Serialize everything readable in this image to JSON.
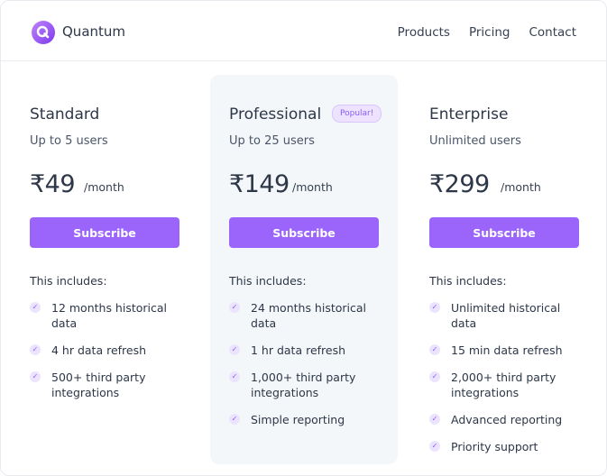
{
  "brand": {
    "name": "Quantum",
    "logo_icon": "q-logo-icon",
    "accent": "#8b5cf6"
  },
  "nav": {
    "links": [
      "Products",
      "Pricing",
      "Contact"
    ]
  },
  "plans": [
    {
      "name": "Standard",
      "users": "Up to 5 users",
      "price": "₹49",
      "period": "/month",
      "button": "Subscribe",
      "includes_label": "This includes:",
      "features": [
        "12 months historical data",
        "4 hr data refresh",
        "500+ third party integrations"
      ]
    },
    {
      "name": "Professional",
      "badge": "Popular!",
      "users": "Up to 25 users",
      "price": "₹149",
      "period": "/month",
      "button": "Subscribe",
      "includes_label": "This includes:",
      "features": [
        "24 months historical data",
        "1 hr data refresh",
        "1,000+ third party integrations",
        "Simple reporting"
      ]
    },
    {
      "name": "Enterprise",
      "users": "Unlimited users",
      "price": "₹299",
      "period": "/month",
      "button": "Subscribe",
      "includes_label": "This includes:",
      "features": [
        "Unlimited historical data",
        "15 min data refresh",
        "2,000+ third party integrations",
        "Advanced reporting",
        "Priority support"
      ]
    }
  ],
  "colors": {
    "button": "#9b65fb",
    "check": "#8b5cf6",
    "popular_bg": "#f4f7fa"
  }
}
